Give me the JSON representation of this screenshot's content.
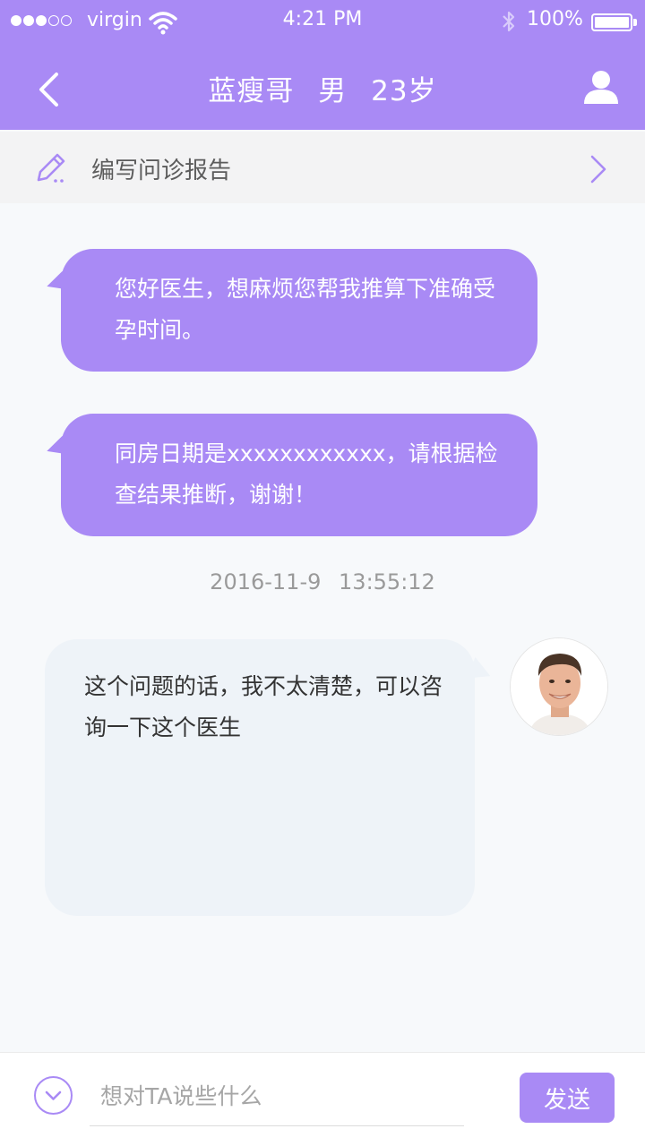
{
  "status_bar": {
    "signal_dots": [
      "on",
      "on",
      "on",
      "off",
      "off"
    ],
    "carrier": "virgin",
    "time": "4:21 PM",
    "battery": "100%",
    "icons": [
      "wifi-icon",
      "bluetooth-icon",
      "battery-icon"
    ]
  },
  "header": {
    "name": "蓝瘦哥",
    "gender": "男",
    "age": "23岁",
    "icons": [
      "back-arrow-icon",
      "user-profile-icon"
    ]
  },
  "report_bar": {
    "label": "编写问诊报告",
    "icons": [
      "pencil-icon",
      "chevron-right-icon"
    ]
  },
  "messages": [
    {
      "sender": "patient",
      "text": "您好医生，想麻烦您帮我推算下准确受孕时间。"
    },
    {
      "sender": "patient",
      "text": "同房日期是xxxxxxxxxxxx，请根据检查结果推断，谢谢！"
    },
    {
      "sender": "doctor",
      "text": "这个问题的话，我不太清楚，可以咨询一下这个医生"
    }
  ],
  "timestamp": {
    "date": "2016-11-9",
    "time": "13:55:12"
  },
  "composer": {
    "placeholder": "想对TA说些什么",
    "send_label": "发送",
    "icons": [
      "chevron-down-circle-icon"
    ]
  },
  "colors": {
    "accent": "#a98af5",
    "doctor_bubble": "#eef3f8",
    "background": "#f7f9fb"
  }
}
